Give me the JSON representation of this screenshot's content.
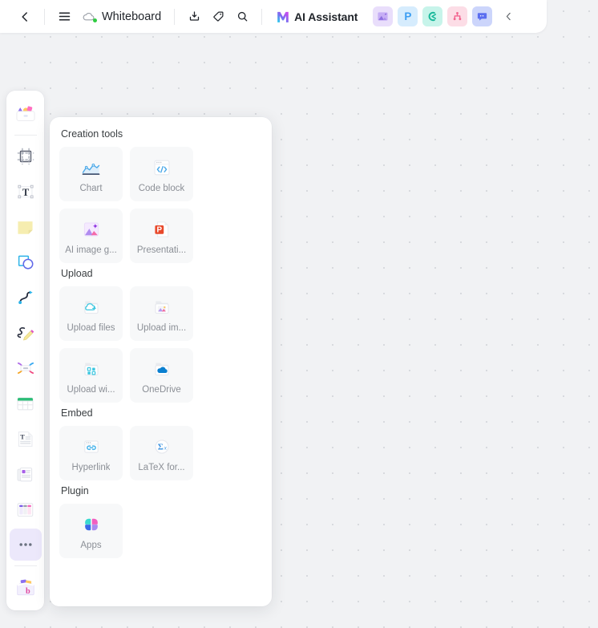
{
  "header": {
    "back_icon": "chevron-left-icon",
    "menu_icon": "hamburger-menu-icon",
    "cloud_icon": "cloud-sync-icon",
    "title": "Whiteboard",
    "download_icon": "download-icon",
    "tag_icon": "tag-icon",
    "search_icon": "search-icon",
    "ai_assistant_label": "AI Assistant",
    "app_chips": [
      {
        "name": "ai-image-app",
        "glyph": "image",
        "bg": "#e9defb",
        "fg": "#9b7ae0"
      },
      {
        "name": "presentation-app",
        "glyph": "P",
        "bg": "#d6ecfd",
        "fg": "#3b9df2"
      },
      {
        "name": "mindmap-app",
        "glyph": "C",
        "bg": "#c7f4ea",
        "fg": "#18b89a"
      },
      {
        "name": "flowchart-app",
        "glyph": "T",
        "bg": "#fcdde6",
        "fg": "#f2648f"
      },
      {
        "name": "chat-app",
        "glyph": "chat",
        "bg": "#ccd5fb",
        "fg": "#5b6ef0"
      }
    ],
    "collapse_icon": "chevron-left-icon"
  },
  "left_toolbar": {
    "items": [
      {
        "name": "shapes-drawer-tool",
        "icon": "shapes-drawer-icon"
      },
      {
        "name": "frame-tool",
        "icon": "frame-icon"
      },
      {
        "name": "text-tool",
        "icon": "text-box-icon"
      },
      {
        "name": "sticky-note-tool",
        "icon": "sticky-note-icon"
      },
      {
        "name": "shape-tool",
        "icon": "square-circle-icon"
      },
      {
        "name": "connector-tool",
        "icon": "curve-connector-icon"
      },
      {
        "name": "pen-tool",
        "icon": "pencil-scribble-icon"
      },
      {
        "name": "mind-map-tool",
        "icon": "mind-map-icon"
      },
      {
        "name": "table-tool",
        "icon": "table-icon"
      },
      {
        "name": "document-tool",
        "icon": "text-document-icon"
      },
      {
        "name": "card-stack-tool",
        "icon": "card-stack-icon"
      },
      {
        "name": "kanban-tool",
        "icon": "kanban-columns-icon"
      },
      {
        "name": "more-tools",
        "icon": "ellipsis-icon"
      },
      {
        "name": "template-library-tool",
        "icon": "template-box-icon"
      }
    ]
  },
  "panel": {
    "sections": [
      {
        "title": "Creation tools",
        "items": [
          {
            "label": "Chart",
            "icon": "area-chart-icon",
            "name": "chart-card"
          },
          {
            "label": "Code block",
            "icon": "code-block-icon",
            "name": "code-block-card"
          },
          {
            "label": "AI image g...",
            "icon": "ai-image-icon",
            "name": "ai-image-generation-card"
          },
          {
            "label": "Presentati...",
            "icon": "powerpoint-icon",
            "name": "presentation-card"
          }
        ]
      },
      {
        "title": "Upload",
        "items": [
          {
            "label": "Upload files",
            "icon": "upload-folder-icon",
            "name": "upload-files-card"
          },
          {
            "label": "Upload im...",
            "icon": "image-folder-icon",
            "name": "upload-images-card"
          },
          {
            "label": "Upload wi...",
            "icon": "widget-folder-icon",
            "name": "upload-widgets-card"
          },
          {
            "label": "OneDrive",
            "icon": "onedrive-folder-icon",
            "name": "onedrive-card"
          }
        ]
      },
      {
        "title": "Embed",
        "items": [
          {
            "label": "Hyperlink",
            "icon": "hyperlink-icon",
            "name": "hyperlink-card"
          },
          {
            "label": "LaTeX for...",
            "icon": "latex-formula-icon",
            "name": "latex-formula-card"
          }
        ]
      },
      {
        "title": "Plugin",
        "items": [
          {
            "label": "Apps",
            "icon": "apps-grid-icon",
            "name": "apps-card"
          }
        ]
      }
    ]
  },
  "colors": {
    "canvas_bg": "#f1f2f4",
    "dot": "#d8dade",
    "panel_bg": "#ffffff",
    "card_bg": "#f7f8f9",
    "label_gray": "#8b8f96",
    "title_dark": "#1f2329"
  }
}
